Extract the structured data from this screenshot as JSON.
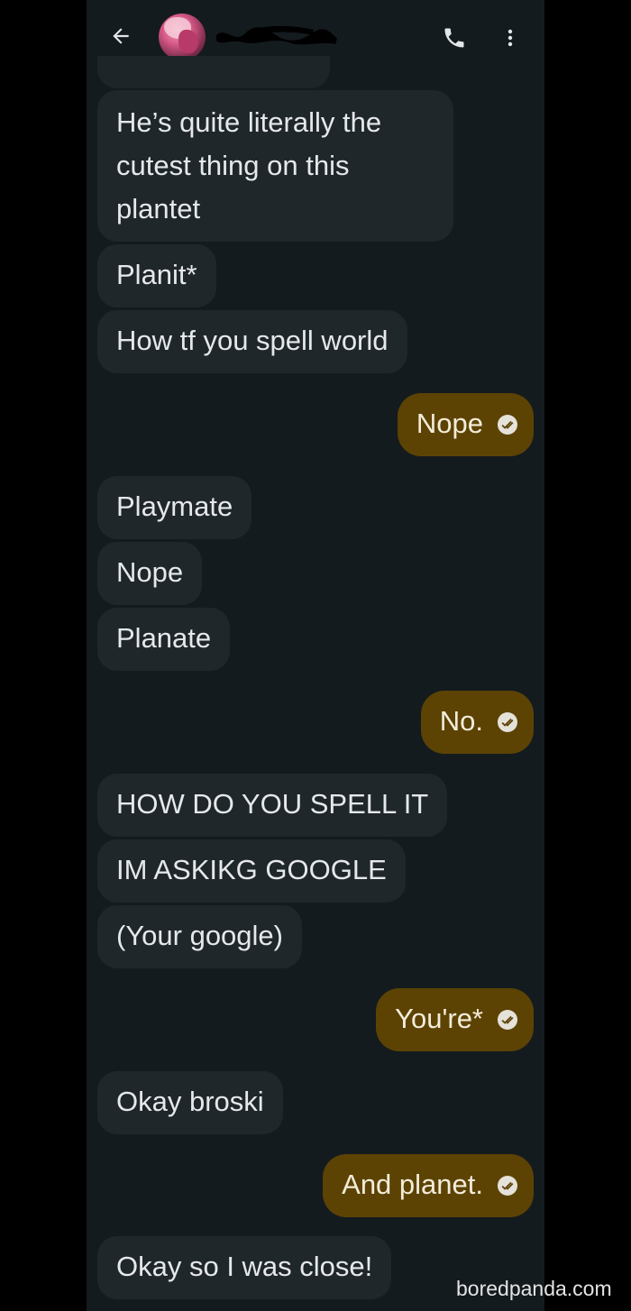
{
  "header": {
    "back_icon": "arrow-left-icon",
    "call_icon": "phone-icon",
    "more_icon": "more-vert-icon"
  },
  "messages": [
    {
      "side": "recv",
      "text": "He’s quite literally the cutest thing on this plantet"
    },
    {
      "side": "recv",
      "text": "Planit*"
    },
    {
      "side": "recv",
      "text": "How tf you spell world"
    },
    {
      "side": "sent",
      "text": "Nope"
    },
    {
      "side": "recv",
      "text": "Playmate"
    },
    {
      "side": "recv",
      "text": "Nope"
    },
    {
      "side": "recv",
      "text": "Planate"
    },
    {
      "side": "sent",
      "text": "No."
    },
    {
      "side": "recv",
      "text": "HOW DO YOU SPELL IT"
    },
    {
      "side": "recv",
      "text": "IM ASKIKG GOOGLE"
    },
    {
      "side": "recv",
      "text": "(Your google)"
    },
    {
      "side": "sent",
      "text": "You're*"
    },
    {
      "side": "recv",
      "text": "Okay broski"
    },
    {
      "side": "sent",
      "text": "And planet."
    },
    {
      "side": "recv",
      "text": "Okay so I was close!"
    }
  ],
  "status_icon": "read-check-icon",
  "watermark": "boredpanda.com",
  "colors": {
    "background": "#141b1f",
    "received_bubble": "#1f272b",
    "sent_bubble": "#5c4304",
    "text": "#e6e8ea"
  }
}
